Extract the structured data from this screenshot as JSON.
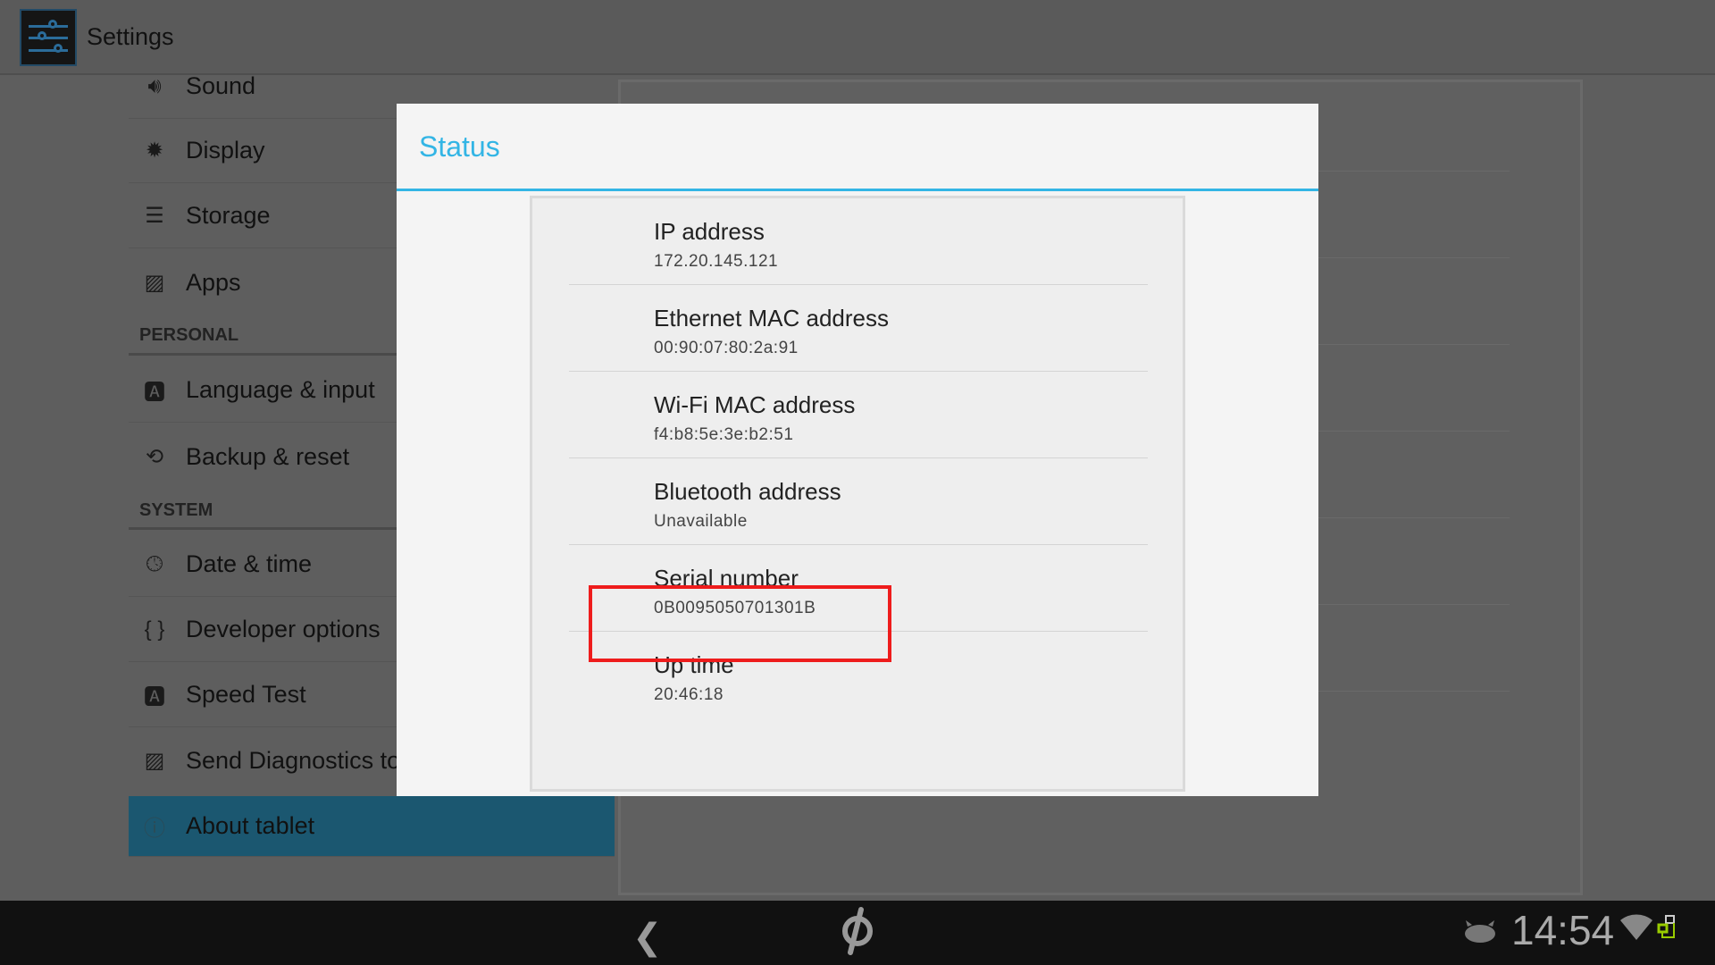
{
  "app": {
    "title": "Settings",
    "icon": "settings-sliders-icon"
  },
  "sidebar": {
    "items": [
      {
        "label": "Sound",
        "icon": "speaker-icon"
      },
      {
        "label": "Display",
        "icon": "brightness-icon"
      },
      {
        "label": "Storage",
        "icon": "storage-icon"
      },
      {
        "label": "Apps",
        "icon": "apps-icon"
      },
      {
        "label": "Language & input",
        "icon": "keyboard-a-icon"
      },
      {
        "label": "Backup & reset",
        "icon": "backup-icon"
      },
      {
        "label": "Date & time",
        "icon": "clock-icon"
      },
      {
        "label": "Developer options",
        "icon": "braces-icon"
      },
      {
        "label": "Speed Test",
        "icon": "speedtest-a-icon"
      },
      {
        "label": "Send Diagnostics to",
        "icon": "diagnostics-icon"
      },
      {
        "label": "About tablet",
        "icon": "info-icon",
        "selected": true
      }
    ],
    "headers": {
      "personal": "PERSONAL",
      "system": "SYSTEM"
    }
  },
  "dialog": {
    "title": "Status",
    "items": [
      {
        "title": "IP address",
        "value": "172.20.145.121"
      },
      {
        "title": "Ethernet MAC address",
        "value": "00:90:07:80:2a:91"
      },
      {
        "title": "Wi-Fi MAC address",
        "value": "f4:b8:5e:3e:b2:51"
      },
      {
        "title": "Bluetooth address",
        "value": "Unavailable"
      },
      {
        "title": "Serial number",
        "value": "0B0095050701301B",
        "highlighted": true
      },
      {
        "title": "Up time",
        "value": "20:46:18"
      }
    ]
  },
  "statusbar": {
    "time": "14:54",
    "icons": [
      "android-notification-icon",
      "wifi-icon",
      "ethernet-icon"
    ]
  },
  "navbar": {
    "icons": [
      "back-icon",
      "peloton-home-icon"
    ]
  },
  "colors": {
    "accent": "#33b5e5",
    "highlight_box": "#ee1c1c",
    "selected_item": "#1b5770"
  }
}
